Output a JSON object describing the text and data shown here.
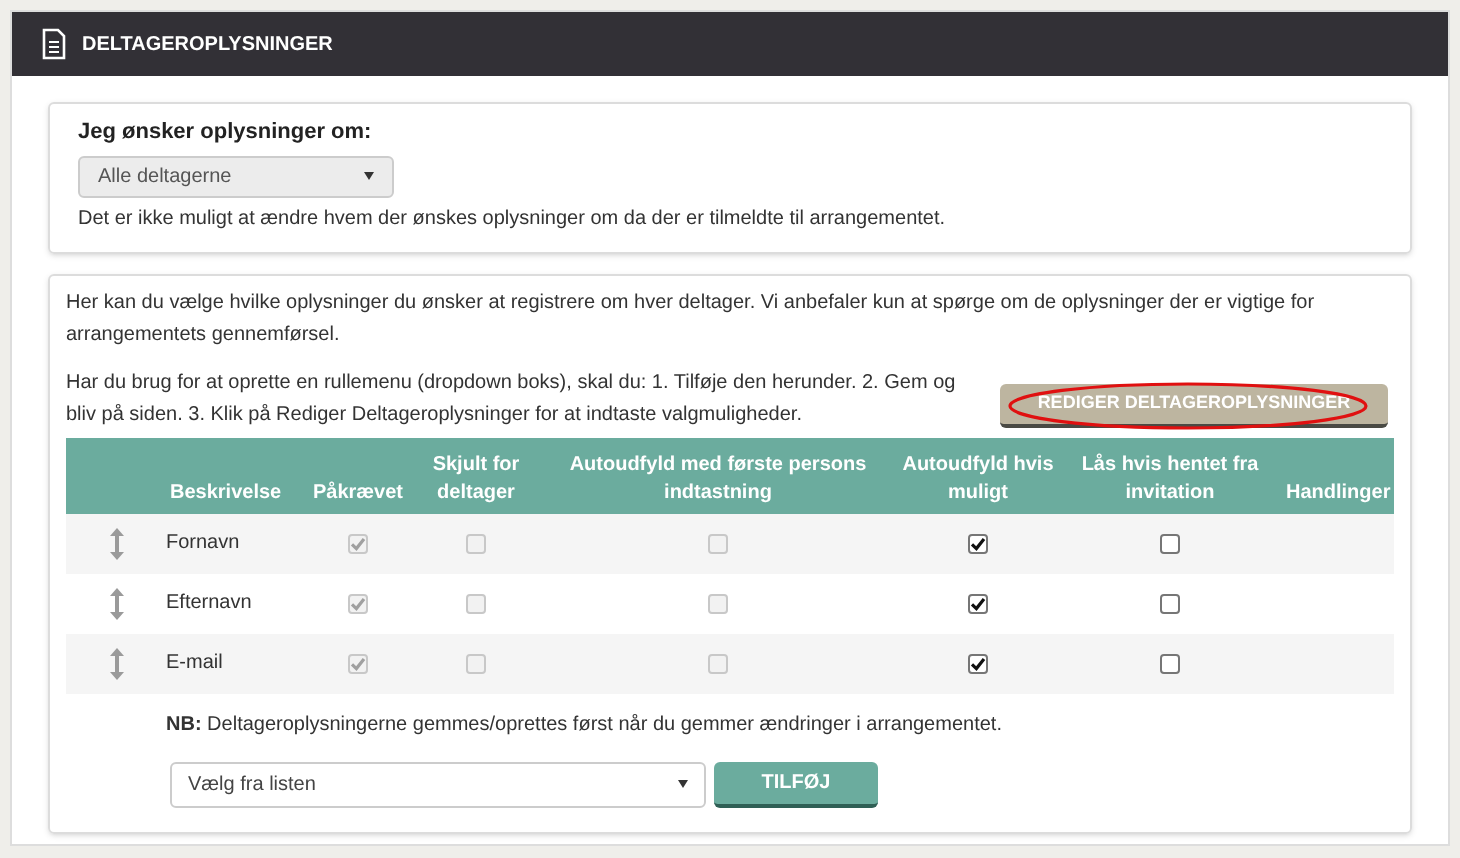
{
  "header": {
    "title": "DELTAGEROPLYSNINGER"
  },
  "scope": {
    "label": "Jeg ønsker oplysninger om:",
    "select_value": "Alle deltagerne",
    "note": "Det er ikke muligt at ændre hvem der ønskes oplysninger om da der er tilmeldte til arrangementet."
  },
  "fields_panel": {
    "intro": "Her kan du vælge hvilke oplysninger du ønsker at registrere om hver deltager. Vi anbefaler kun at spørge om de oplysninger der er vigtige for arrangementets gennemførsel.",
    "help": "Har du brug for at oprette en rullemenu (dropdown boks), skal du: 1. Tilføje den herunder. 2. Gem og bliv på siden. 3. Klik på Rediger Deltageroplysninger for at indtaste valgmuligheder.",
    "edit_button": {
      "label": "REDIGER DELTAGEROPLYSNINGER",
      "circled": true
    },
    "columns": [
      "Beskrivelse",
      "Påkrævet",
      "Skjult for deltager",
      "Autoudfyld med første persons indtastning",
      "Autoudfyld hvis muligt",
      "Lås hvis hentet fra invitation",
      "Handlinger"
    ],
    "rows": [
      {
        "name": "Fornavn",
        "flags": [
          {
            "checked": true,
            "disabled": true
          },
          {
            "checked": false,
            "disabled": true
          },
          {
            "checked": false,
            "disabled": true
          },
          {
            "checked": true,
            "disabled": false
          },
          {
            "checked": false,
            "disabled": false
          }
        ]
      },
      {
        "name": "Efternavn",
        "flags": [
          {
            "checked": true,
            "disabled": true
          },
          {
            "checked": false,
            "disabled": true
          },
          {
            "checked": false,
            "disabled": true
          },
          {
            "checked": true,
            "disabled": false
          },
          {
            "checked": false,
            "disabled": false
          }
        ]
      },
      {
        "name": "E-mail",
        "flags": [
          {
            "checked": true,
            "disabled": true
          },
          {
            "checked": false,
            "disabled": true
          },
          {
            "checked": false,
            "disabled": true
          },
          {
            "checked": true,
            "disabled": false
          },
          {
            "checked": false,
            "disabled": false
          }
        ]
      }
    ],
    "note": "**NB:** Deltageroplysningerne gemmes/oprettes først når du gemmer ændringer i arrangementet.",
    "add_select": "Vælg fra listen",
    "add_button": "TILFØJ"
  }
}
